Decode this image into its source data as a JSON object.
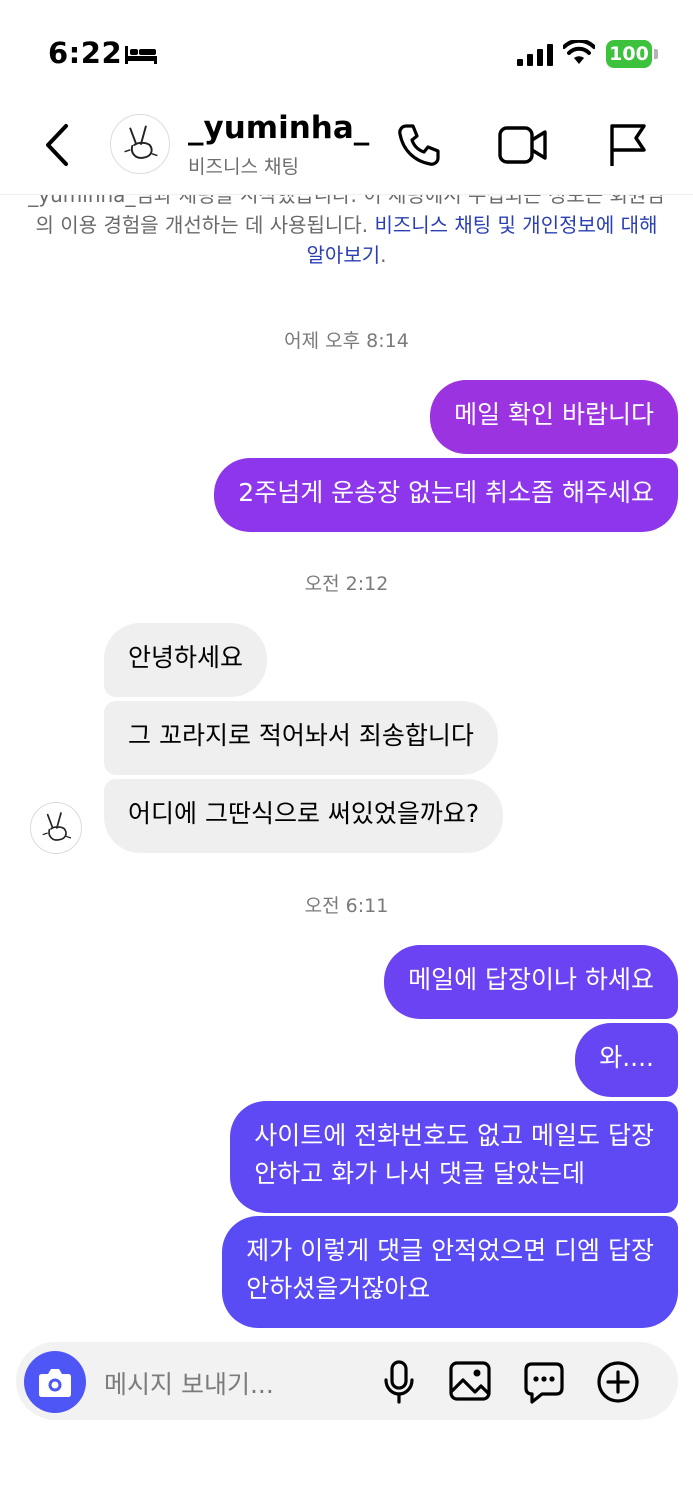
{
  "status_bar": {
    "time": "6:22",
    "battery": "100"
  },
  "header": {
    "name": "_yuminha_",
    "subtitle": "비즈니스 채팅"
  },
  "notice": {
    "line1": "_yuminha_님과 채팅을 시작했습니다. 이 채팅에서 수집되는 정보는 회원님",
    "line2_text": "의 이용 경험을 개선하는 데 사용됩니다. ",
    "line2_link": "비즈니스 채팅 및 개인정보에 대해",
    "line3_link": "알아보기",
    "line3_end": "."
  },
  "timestamps": [
    "어제 오후 8:14",
    "오전 2:12",
    "오전 6:11"
  ],
  "messages": {
    "m1": "메일 확인 바랍니다",
    "m2": "2주넘게 운송장 없는데 취소좀 해주세요",
    "m3": "안녕하세요",
    "m4": "그 꼬라지로 적어놔서 죄송합니다",
    "m5": "어디에 그딴식으로 써있었을까요?",
    "m6": "메일에 답장이나 하세요",
    "m7": "와....",
    "m8_line1": "사이트에 전화번호도 없고 메일도 답장",
    "m8_line2": "안하고 화가 나서 댓글 달았는데",
    "m9_line1": "제가 이렇게 댓글 안적었으면 디엠 답장",
    "m9_line2": "안하셨을거잖아요"
  },
  "composer": {
    "placeholder": "메시지 보내기..."
  },
  "colors": {
    "out_bubble_top": "#9b34e0",
    "out_bubble_mid": "#7e3ff0",
    "out_bubble_bottom": "#5a4cf5",
    "in_bubble": "#efefef",
    "camera_button": "#4e56f5",
    "battery": "#3dc23d"
  }
}
